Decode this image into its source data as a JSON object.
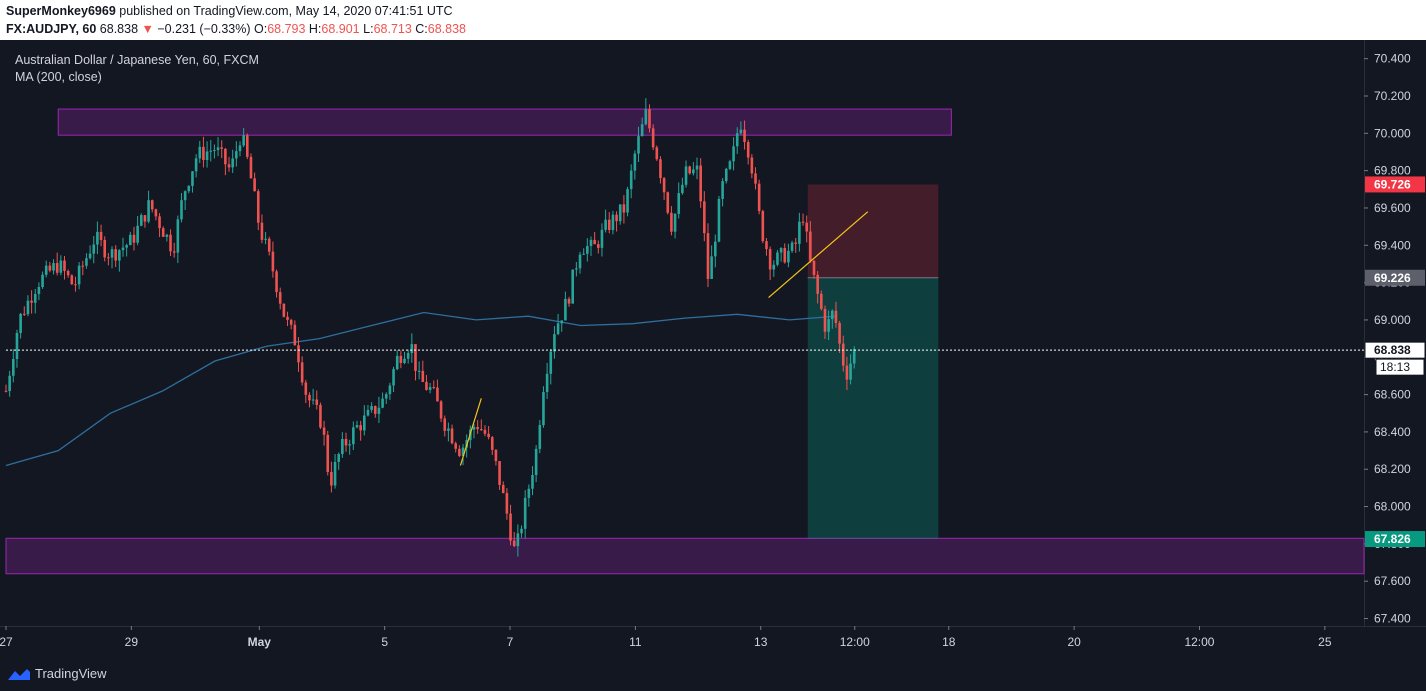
{
  "header": {
    "publisher": "SuperMonkey6969",
    "published_text": "published on TradingView.com, May 14, 2020 07:41:51 UTC",
    "symbol": "FX:AUDJPY, 60",
    "last": "68.838",
    "change": "−0.231 (−0.33%)",
    "o_label": "O:",
    "o_val": "68.793",
    "h_label": "H:",
    "h_val": "68.901",
    "l_label": "L:",
    "l_val": "68.713",
    "c_label": "C:",
    "c_val": "68.838"
  },
  "legend": {
    "title": "Australian Dollar / Japanese Yen, 60, FXCM",
    "indicator": "MA (200, close)"
  },
  "footer": {
    "brand": "TradingView"
  },
  "colors": {
    "background": "#131722",
    "up": "#26a69a",
    "down": "#ef5350",
    "ma": "#2f6e9e",
    "zone": "#9c27b0",
    "stop": "#f23645",
    "target": "#089981",
    "trendline": "#f5c518"
  },
  "chart_data": {
    "type": "candlestick",
    "symbol": "FX:AUDJPY",
    "timeframe": "60",
    "ylim": [
      67.36,
      70.5
    ],
    "y_ticks": [
      "70.400",
      "70.200",
      "70.000",
      "69.800",
      "69.600",
      "69.400",
      "69.200",
      "69.000",
      "68.800",
      "68.600",
      "68.400",
      "68.200",
      "68.000",
      "67.800",
      "67.600",
      "67.400"
    ],
    "x_ticks": [
      "27",
      "29",
      "May",
      "5",
      "7",
      "11",
      "13",
      "12:00",
      "18",
      "20",
      "12:00",
      "25"
    ],
    "x_tick_positions": [
      0,
      48,
      97,
      145,
      193,
      241,
      289,
      325,
      361,
      409,
      457,
      505
    ],
    "price_labels": [
      {
        "value": 69.726,
        "text": "69.726",
        "kind": "stop"
      },
      {
        "value": 69.226,
        "text": "69.226",
        "kind": "entry"
      },
      {
        "value": 68.838,
        "text": "68.838",
        "kind": "last"
      },
      {
        "value": 67.826,
        "text": "67.826",
        "kind": "target"
      }
    ],
    "countdown": "18:13",
    "last_price": 68.838,
    "zones": [
      {
        "from": 69.99,
        "to": 70.13,
        "x_start": 20,
        "x_end": 362
      },
      {
        "from": 67.64,
        "to": 67.83,
        "x_start": 0,
        "x_end": 520
      }
    ],
    "position": {
      "x_start": 307,
      "x_end": 357,
      "entry": 69.226,
      "stop": 69.726,
      "target": 67.826
    },
    "trendlines": [
      {
        "x1": 174,
        "y1": 68.22,
        "x2": 182,
        "y2": 68.58
      },
      {
        "x1": 292,
        "y1": 69.12,
        "x2": 330,
        "y2": 69.58
      }
    ],
    "series_path": [
      [
        0,
        68.62
      ],
      [
        5,
        69.0
      ],
      [
        12,
        69.2
      ],
      [
        20,
        69.3
      ],
      [
        26,
        69.18
      ],
      [
        34,
        69.44
      ],
      [
        40,
        69.35
      ],
      [
        48,
        69.42
      ],
      [
        55,
        69.62
      ],
      [
        64,
        69.38
      ],
      [
        68,
        69.68
      ],
      [
        73,
        69.88
      ],
      [
        80,
        69.92
      ],
      [
        86,
        69.8
      ],
      [
        90,
        70.0
      ],
      [
        93,
        69.82
      ],
      [
        97,
        69.5
      ],
      [
        102,
        69.28
      ],
      [
        107,
        69.0
      ],
      [
        111,
        68.88
      ],
      [
        115,
        68.6
      ],
      [
        121,
        68.45
      ],
      [
        124,
        68.12
      ],
      [
        128,
        68.3
      ],
      [
        134,
        68.42
      ],
      [
        140,
        68.5
      ],
      [
        145,
        68.58
      ],
      [
        150,
        68.8
      ],
      [
        155,
        68.88
      ],
      [
        158,
        68.68
      ],
      [
        163,
        68.62
      ],
      [
        168,
        68.45
      ],
      [
        174,
        68.3
      ],
      [
        180,
        68.45
      ],
      [
        184,
        68.38
      ],
      [
        188,
        68.2
      ],
      [
        192,
        67.95
      ],
      [
        195,
        67.74
      ],
      [
        198,
        67.95
      ],
      [
        203,
        68.3
      ],
      [
        206,
        68.68
      ],
      [
        210,
        68.95
      ],
      [
        215,
        69.1
      ],
      [
        220,
        69.4
      ],
      [
        225,
        69.38
      ],
      [
        230,
        69.5
      ],
      [
        237,
        69.6
      ],
      [
        241,
        69.9
      ],
      [
        245,
        70.1
      ],
      [
        249,
        69.9
      ],
      [
        255,
        69.5
      ],
      [
        260,
        69.78
      ],
      [
        265,
        69.8
      ],
      [
        269,
        69.2
      ],
      [
        274,
        69.7
      ],
      [
        278,
        69.85
      ],
      [
        281,
        70.08
      ],
      [
        285,
        69.88
      ],
      [
        289,
        69.5
      ],
      [
        293,
        69.3
      ],
      [
        298,
        69.35
      ],
      [
        302,
        69.38
      ],
      [
        305,
        69.58
      ],
      [
        308,
        69.3
      ],
      [
        311,
        69.12
      ],
      [
        314,
        68.95
      ],
      [
        317,
        69.05
      ],
      [
        320,
        68.8
      ],
      [
        322,
        68.72
      ],
      [
        325,
        68.84
      ]
    ],
    "ma_path": [
      [
        0,
        68.22
      ],
      [
        20,
        68.3
      ],
      [
        40,
        68.5
      ],
      [
        60,
        68.62
      ],
      [
        80,
        68.78
      ],
      [
        100,
        68.86
      ],
      [
        120,
        68.9
      ],
      [
        140,
        68.97
      ],
      [
        160,
        69.04
      ],
      [
        180,
        69.0
      ],
      [
        200,
        69.02
      ],
      [
        220,
        68.97
      ],
      [
        240,
        68.98
      ],
      [
        260,
        69.01
      ],
      [
        280,
        69.03
      ],
      [
        300,
        69.0
      ],
      [
        318,
        69.02
      ]
    ]
  }
}
